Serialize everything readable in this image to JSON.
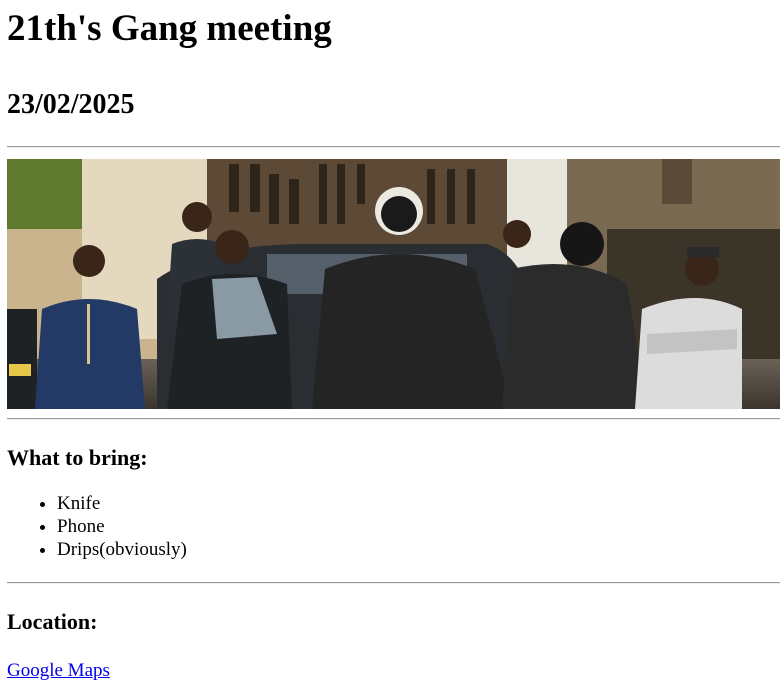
{
  "page": {
    "title": "21th's Gang meeting",
    "date": "23/02/2025"
  },
  "bring": {
    "heading": "What to bring:",
    "items": [
      "Knife",
      "Phone",
      "Drips(obviously)"
    ]
  },
  "location": {
    "heading": "Location:",
    "link_label": "Google Maps"
  },
  "colors": {
    "link": "#0000ee",
    "rule": "#9a9a9a"
  }
}
